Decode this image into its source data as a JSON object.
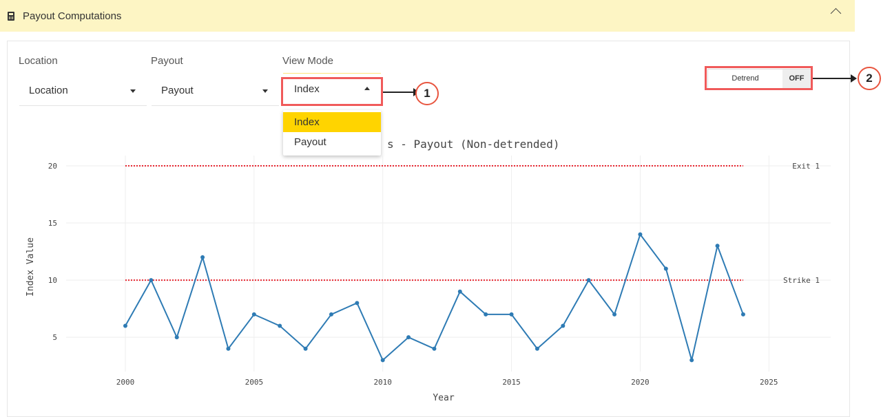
{
  "header": {
    "title": "Payout Computations"
  },
  "filters": {
    "location": {
      "label": "Location",
      "value": "Location"
    },
    "payout": {
      "label": "Payout",
      "value": "Payout"
    },
    "view_mode": {
      "label": "View Mode",
      "value": "Index",
      "options": [
        "Index",
        "Payout"
      ]
    }
  },
  "detrend_toggle": {
    "label": "Detrend",
    "state": "OFF"
  },
  "annotations": {
    "callout_1": "1",
    "callout_2": "2"
  },
  "colors": {
    "header_bg": "#fdf5c4",
    "accent": "#ffd400",
    "highlight": "#f05a5a",
    "series": "#2e7bb4",
    "threshold": "#e8212b"
  },
  "chart_data": {
    "type": "line",
    "title": "s - Payout (Non-detrended)",
    "xlabel": "Year",
    "ylabel": "Index Value",
    "xlim": [
      1997.7,
      2027.4
    ],
    "ylim": [
      2,
      20.9
    ],
    "x_ticks": [
      2000,
      2005,
      2010,
      2015,
      2020,
      2025
    ],
    "y_ticks": [
      5,
      10,
      15,
      20
    ],
    "x": [
      2000,
      2001,
      2002,
      2003,
      2004,
      2005,
      2006,
      2007,
      2008,
      2009,
      2010,
      2011,
      2012,
      2013,
      2014,
      2015,
      2016,
      2017,
      2018,
      2019,
      2020,
      2021,
      2022,
      2023,
      2024
    ],
    "values": [
      6,
      10,
      5,
      12,
      4,
      7,
      6,
      4,
      7,
      8,
      3,
      5,
      4,
      9,
      7,
      7,
      4,
      6,
      10,
      7,
      14,
      11,
      3,
      13,
      7
    ],
    "thresholds": [
      {
        "name": "Exit 1",
        "value": 20
      },
      {
        "name": "Strike 1",
        "value": 10
      }
    ],
    "grid": true
  }
}
